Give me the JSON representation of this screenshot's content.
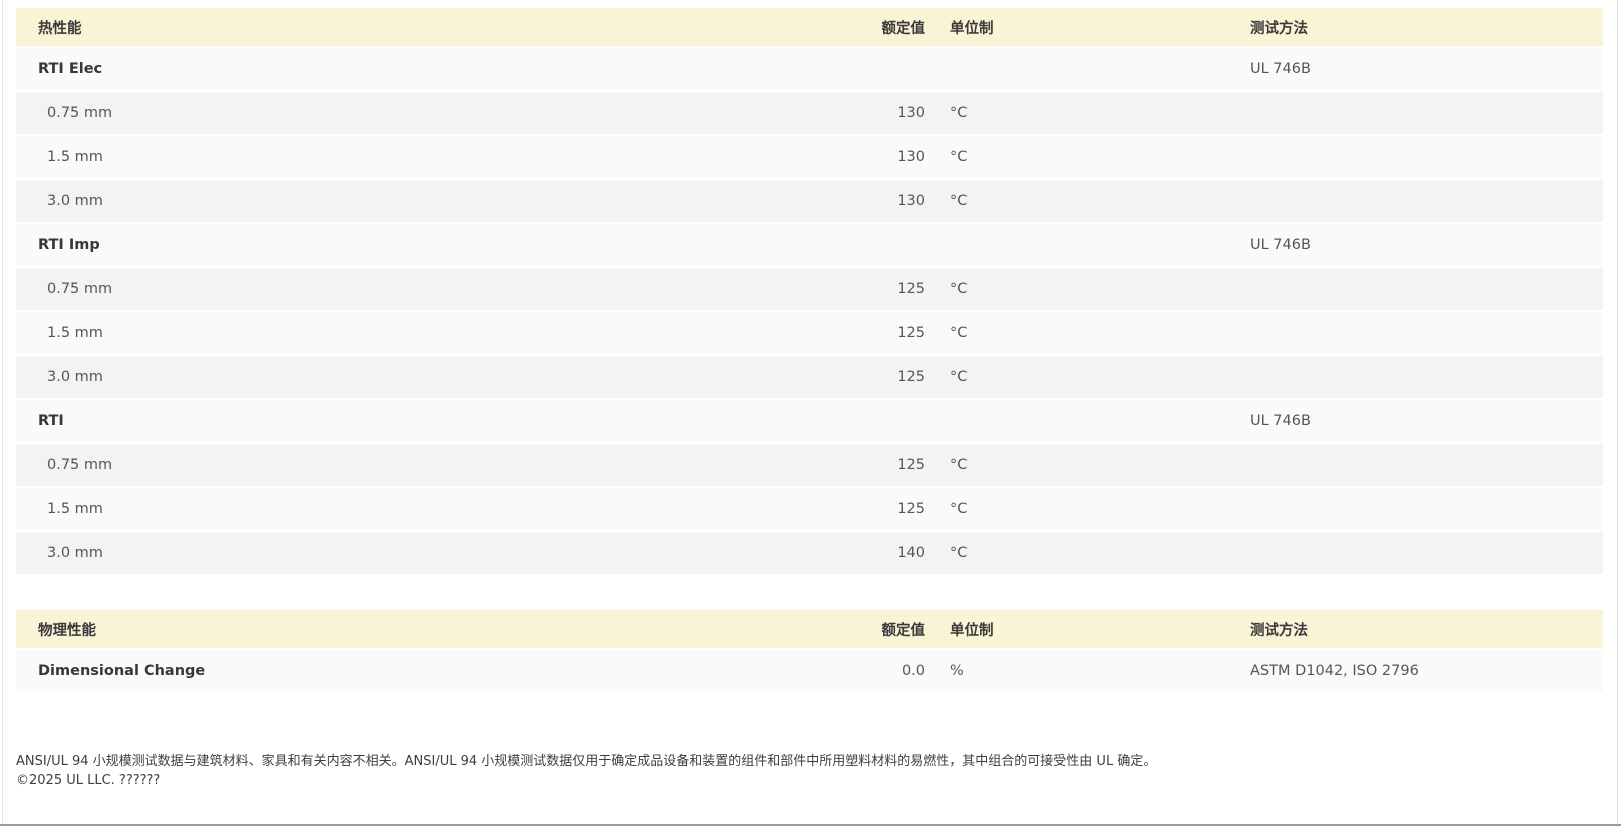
{
  "colors": {
    "section_header_bg": "#faf3d6",
    "row_light": "#fafafa",
    "row_dark": "#f3f3f3",
    "text_dark": "#383838",
    "text_gray": "#565656",
    "bottom_rule": "#9b9b9b"
  },
  "tables": [
    {
      "title": "热性能",
      "columns": {
        "value": "额定值",
        "unit": "单位制",
        "method": "测试方法"
      },
      "rows": [
        {
          "name": "RTI Elec",
          "bold": true,
          "indent": false,
          "value": "",
          "unit": "",
          "method": "UL 746B"
        },
        {
          "name": "0.75 mm",
          "bold": false,
          "indent": true,
          "value": "130",
          "unit": "°C",
          "method": ""
        },
        {
          "name": "1.5 mm",
          "bold": false,
          "indent": true,
          "value": "130",
          "unit": "°C",
          "method": ""
        },
        {
          "name": "3.0 mm",
          "bold": false,
          "indent": true,
          "value": "130",
          "unit": "°C",
          "method": ""
        },
        {
          "name": "RTI Imp",
          "bold": true,
          "indent": false,
          "value": "",
          "unit": "",
          "method": "UL 746B"
        },
        {
          "name": "0.75 mm",
          "bold": false,
          "indent": true,
          "value": "125",
          "unit": "°C",
          "method": ""
        },
        {
          "name": "1.5 mm",
          "bold": false,
          "indent": true,
          "value": "125",
          "unit": "°C",
          "method": ""
        },
        {
          "name": "3.0 mm",
          "bold": false,
          "indent": true,
          "value": "125",
          "unit": "°C",
          "method": ""
        },
        {
          "name": "RTI",
          "bold": true,
          "indent": false,
          "value": "",
          "unit": "",
          "method": "UL 746B"
        },
        {
          "name": "0.75 mm",
          "bold": false,
          "indent": true,
          "value": "125",
          "unit": "°C",
          "method": ""
        },
        {
          "name": "1.5 mm",
          "bold": false,
          "indent": true,
          "value": "125",
          "unit": "°C",
          "method": ""
        },
        {
          "name": "3.0 mm",
          "bold": false,
          "indent": true,
          "value": "140",
          "unit": "°C",
          "method": ""
        }
      ]
    },
    {
      "title": "物理性能",
      "columns": {
        "value": "额定值",
        "unit": "单位制",
        "method": "测试方法"
      },
      "rows": [
        {
          "name": "Dimensional Change",
          "bold": true,
          "indent": false,
          "value": "0.0",
          "unit": "%",
          "method": "ASTM D1042, ISO 2796"
        }
      ]
    }
  ],
  "footer": {
    "footnote": "ANSI/UL 94 小规模测试数据与建筑材料、家具和有关内容不相关。ANSI/UL 94 小规模测试数据仅用于确定成品设备和装置的组件和部件中所用塑料材料的易燃性，其中组合的可接受性由 UL 确定。",
    "copyright": "©2025 UL LLC. ??????"
  }
}
